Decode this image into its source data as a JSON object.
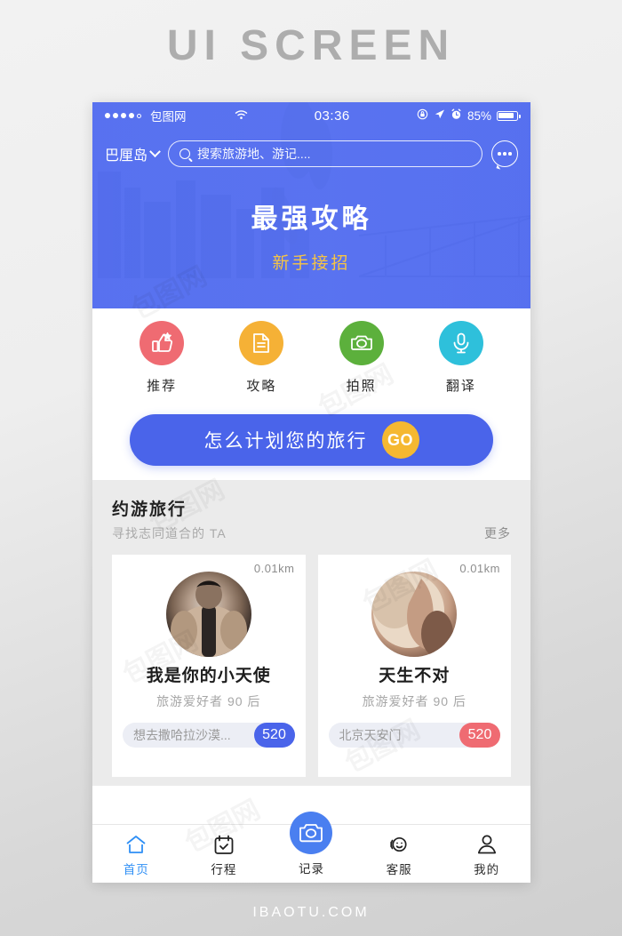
{
  "page": {
    "title": "UI SCREEN",
    "footer": "IBAOTU.COM"
  },
  "colors": {
    "brand_blue": "#5570f0",
    "cta_blue": "#4a64ea",
    "accent_yellow": "#f6c445",
    "go_yellow": "#f5b831",
    "badge_blue": "#4a64ea",
    "badge_pink": "#ef6b72",
    "active_tab": "#2f8ff5",
    "page_bg": "#ebebeb"
  },
  "status_bar": {
    "carrier": "包图网",
    "time": "03:36",
    "battery_percent": "85%",
    "signal_dots": 5,
    "signal_filled": 4,
    "icons": [
      "wifi-icon",
      "rotation-lock-icon",
      "location-arrow-icon",
      "alarm-clock-icon",
      "battery-icon"
    ]
  },
  "header": {
    "city": "巴厘岛",
    "search_placeholder": "搜索旅游地、游记....",
    "more_icon": "speech-bubble-ellipsis-icon",
    "title": "最强攻略",
    "subtitle": "新手接招"
  },
  "quick_actions": [
    {
      "label": "推荐",
      "icon": "thumbs-up-star-icon",
      "color": "#ef6b72"
    },
    {
      "label": "攻略",
      "icon": "document-icon",
      "color": "#f5b136"
    },
    {
      "label": "拍照",
      "icon": "camera-icon",
      "color": "#5cb03c"
    },
    {
      "label": "翻译",
      "icon": "microphone-icon",
      "color": "#2ec0db"
    }
  ],
  "cta": {
    "text": "怎么计划您的旅行",
    "go_label": "GO"
  },
  "section": {
    "title": "约游旅行",
    "subtitle": "寻找志同道合的 TA",
    "more": "更多"
  },
  "cards": [
    {
      "distance": "0.01km",
      "name": "我是你的小天使",
      "desc": "旅游爱好者 90 后",
      "pill_text": "想去撒哈拉沙漠...",
      "badge": "520",
      "badge_color": "blue",
      "avatar": "muscular-man-photo"
    },
    {
      "distance": "0.01km",
      "name": "天生不对",
      "desc": "旅游爱好者 90 后",
      "pill_text": "北京天安门",
      "badge": "520",
      "badge_color": "pink",
      "avatar": "skin-closeup-photo"
    }
  ],
  "tabs": [
    {
      "label": "首页",
      "icon": "home-icon",
      "active": true
    },
    {
      "label": "行程",
      "icon": "calendar-check-icon",
      "active": false
    },
    {
      "label": "记录",
      "icon": "camera-icon",
      "active": false,
      "fab": true
    },
    {
      "label": "客服",
      "icon": "headset-support-icon",
      "active": false
    },
    {
      "label": "我的",
      "icon": "person-icon",
      "active": false
    }
  ]
}
